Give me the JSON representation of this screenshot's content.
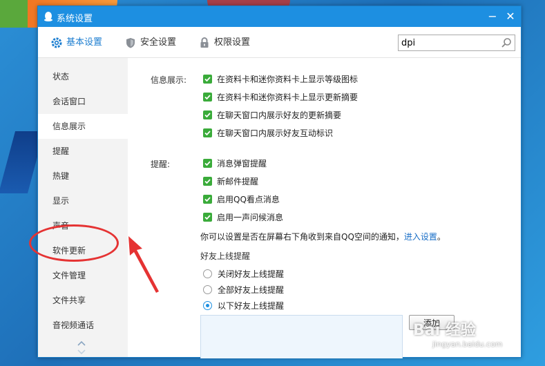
{
  "window": {
    "title": "系统设置",
    "minimize": "−",
    "close": "✕"
  },
  "toolbar": {
    "tabs": [
      {
        "label": "基本设置",
        "icon": "gear-icon",
        "active": true
      },
      {
        "label": "安全设置",
        "icon": "shield-icon",
        "active": false
      },
      {
        "label": "权限设置",
        "icon": "lock-icon",
        "active": false
      }
    ],
    "search": {
      "value": "dpi",
      "placeholder": ""
    }
  },
  "sidebar": {
    "items": [
      {
        "label": "状态"
      },
      {
        "label": "会话窗口"
      },
      {
        "label": "信息展示",
        "active": true
      },
      {
        "label": "提醒"
      },
      {
        "label": "热键"
      },
      {
        "label": "显示"
      },
      {
        "label": "声音"
      },
      {
        "label": "软件更新"
      },
      {
        "label": "文件管理"
      },
      {
        "label": "文件共享"
      },
      {
        "label": "音视频通话"
      }
    ]
  },
  "content": {
    "info_section": {
      "label": "信息展示:",
      "options": [
        {
          "label": "在资料卡和迷你资料卡上显示等级图标",
          "checked": true
        },
        {
          "label": "在资料卡和迷你资料卡上显示更新摘要",
          "checked": true
        },
        {
          "label": "在聊天窗口内展示好友的更新摘要",
          "checked": true
        },
        {
          "label": "在聊天窗口内展示好友互动标识",
          "checked": true
        }
      ]
    },
    "remind_section": {
      "label": "提醒:",
      "options": [
        {
          "label": "消息弹窗提醒",
          "checked": true
        },
        {
          "label": "新邮件提醒",
          "checked": true
        },
        {
          "label": "启用QQ看点消息",
          "checked": true
        },
        {
          "label": "启用一声问候消息",
          "checked": true
        }
      ],
      "note_text": "你可以设置是否在屏幕右下角收到来自QQ空间的通知，",
      "note_link": "进入设置",
      "note_end": "。"
    },
    "friend_online": {
      "title": "好友上线提醒",
      "radios": [
        {
          "label": "关闭好友上线提醒",
          "selected": false
        },
        {
          "label": "全部好友上线提醒",
          "selected": false
        },
        {
          "label": "以下好友上线提醒",
          "selected": true
        }
      ],
      "add_button": "添加"
    }
  },
  "watermark": {
    "main": "Bai 经验",
    "sub": "jingyan.baidu.com"
  },
  "colors": {
    "title_bar": "#1d8fe1",
    "checkbox": "#3aab3a",
    "link": "#1a6fc7",
    "annotation": "#e53333"
  }
}
